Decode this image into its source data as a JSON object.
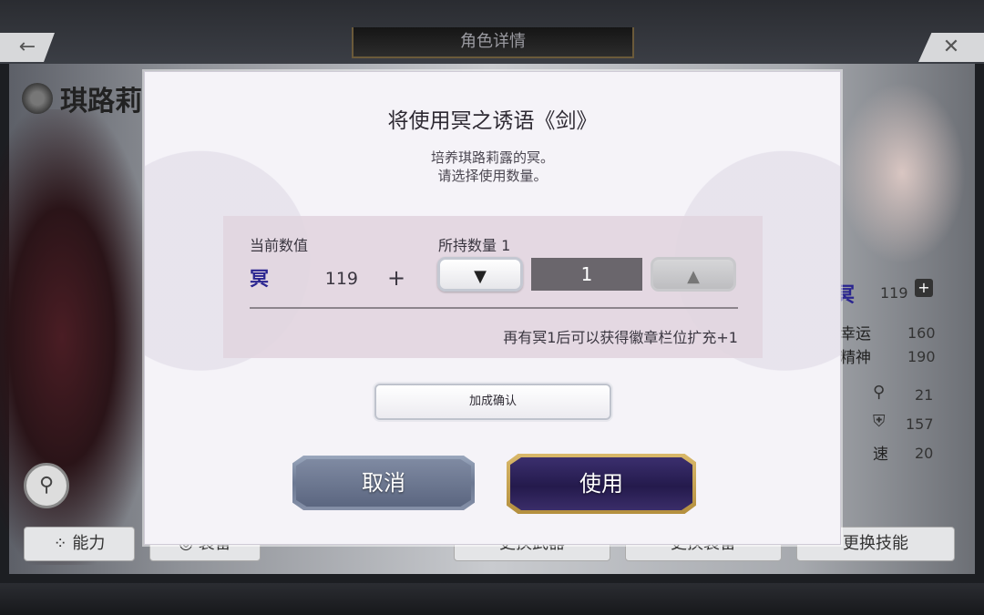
{
  "header": {
    "title": "角色详情"
  },
  "character": {
    "name": "琪路莉"
  },
  "background_stats": {
    "ming_value": "119",
    "luck_label": "幸运",
    "luck_value": "160",
    "spirit_label": "精神",
    "spirit_value": "190",
    "stat_a_value": "21",
    "stat_b_value": "157",
    "speed_label": "速",
    "speed_value": "20"
  },
  "bottom_bar": {
    "ability_label": "能力",
    "equip_label": "装备",
    "change_weapon_label": "更换武器",
    "change_gear_label": "更换装备",
    "change_skill_label": "更换技能"
  },
  "dialog": {
    "title": "将使用冥之诱语《剑》",
    "desc_line1": "培养琪路莉露的冥。",
    "desc_line2": "请选择使用数量。",
    "current_label": "当前数值",
    "held_label": "所持数量 1",
    "ming_symbol": "冥",
    "current_value": "119",
    "plus": "+",
    "down_arrow": "▼",
    "up_arrow": "▲",
    "quantity": "1",
    "hint": "再有冥1后可以获得徽章栏位扩充+1",
    "confirm_bonus_label": "加成确认",
    "cancel_label": "取消",
    "use_label": "使用"
  }
}
